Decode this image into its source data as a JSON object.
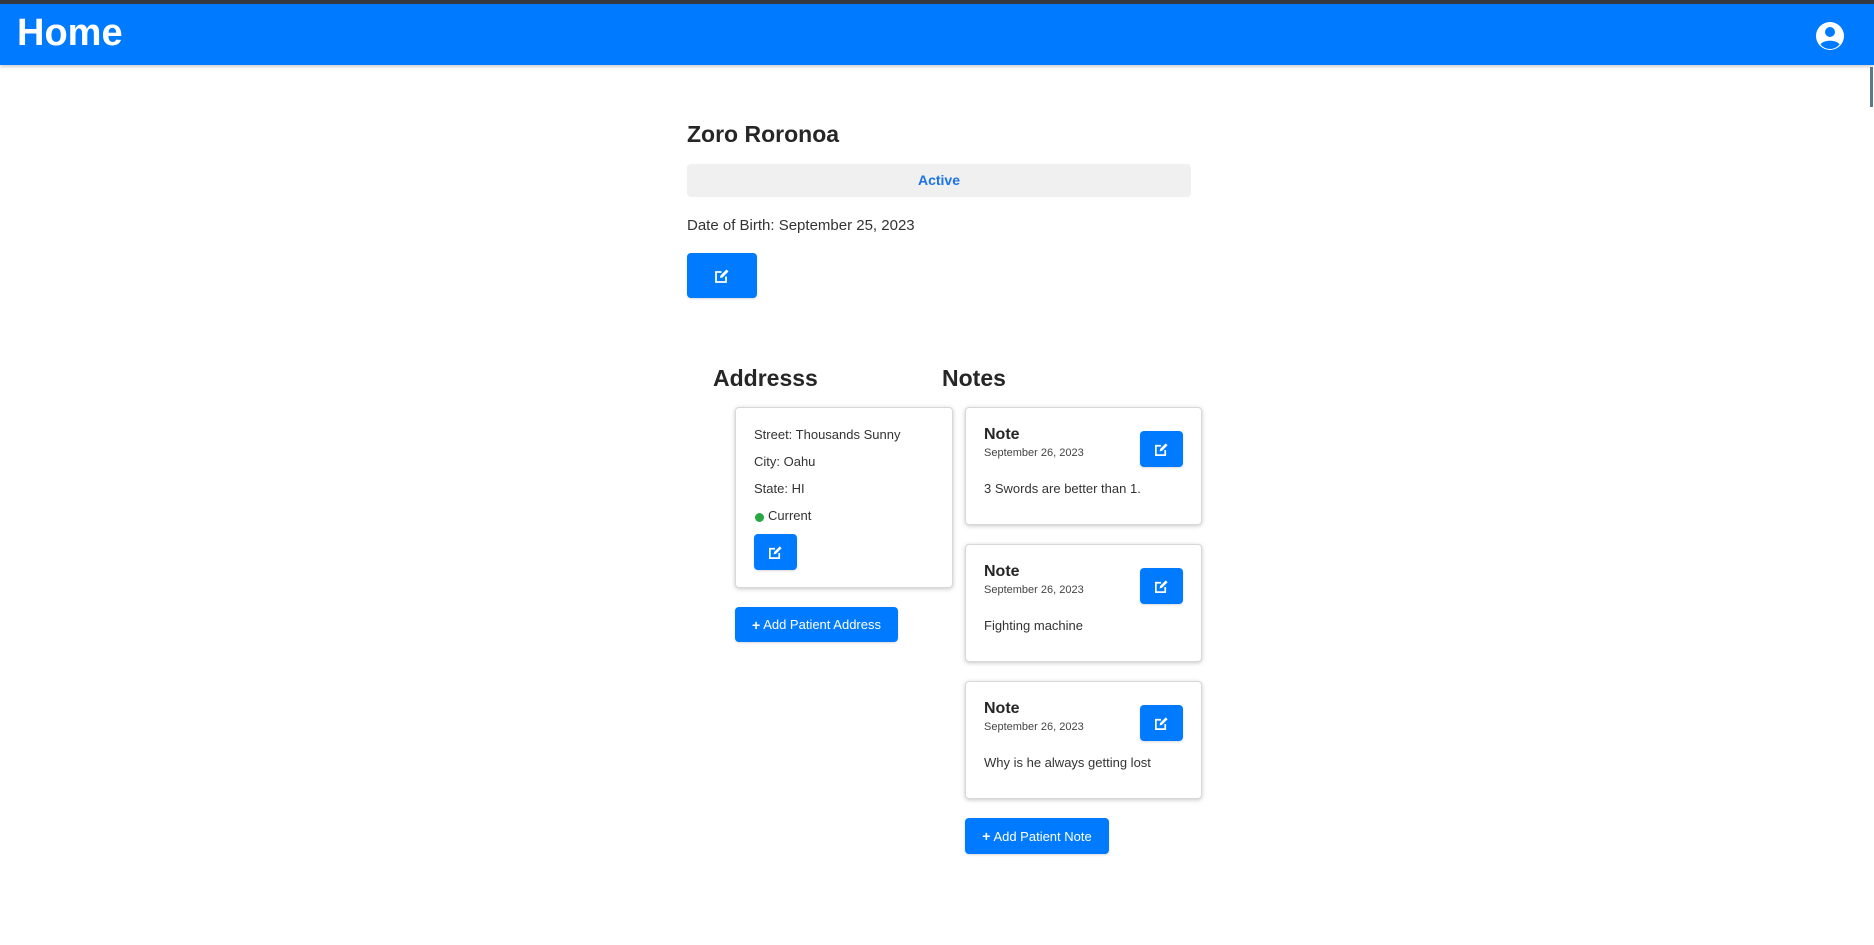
{
  "header": {
    "title": "Home",
    "account_icon": "account-circle-icon",
    "brand_color": "#007bff"
  },
  "patient": {
    "name": "Zoro Roronoa",
    "status": "Active",
    "dob_label": "Date of Birth: September 25, 2023",
    "edit_icon": "edit-icon"
  },
  "addresses": {
    "title": "Addresss",
    "items": [
      {
        "street": "Street: Thousands Sunny",
        "city": "City: Oahu",
        "state": "State: HI",
        "status": "Current",
        "status_color": "#28a745"
      }
    ],
    "add_label": "Add Patient Address"
  },
  "notes": {
    "title": "Notes",
    "items": [
      {
        "title": "Note",
        "date": "September 26, 2023",
        "text": "3 Swords are better than 1."
      },
      {
        "title": "Note",
        "date": "September 26, 2023",
        "text": "Fighting machine"
      },
      {
        "title": "Note",
        "date": "September 26, 2023",
        "text": "Why is he always getting lost"
      }
    ],
    "add_label": "Add Patient Note"
  }
}
